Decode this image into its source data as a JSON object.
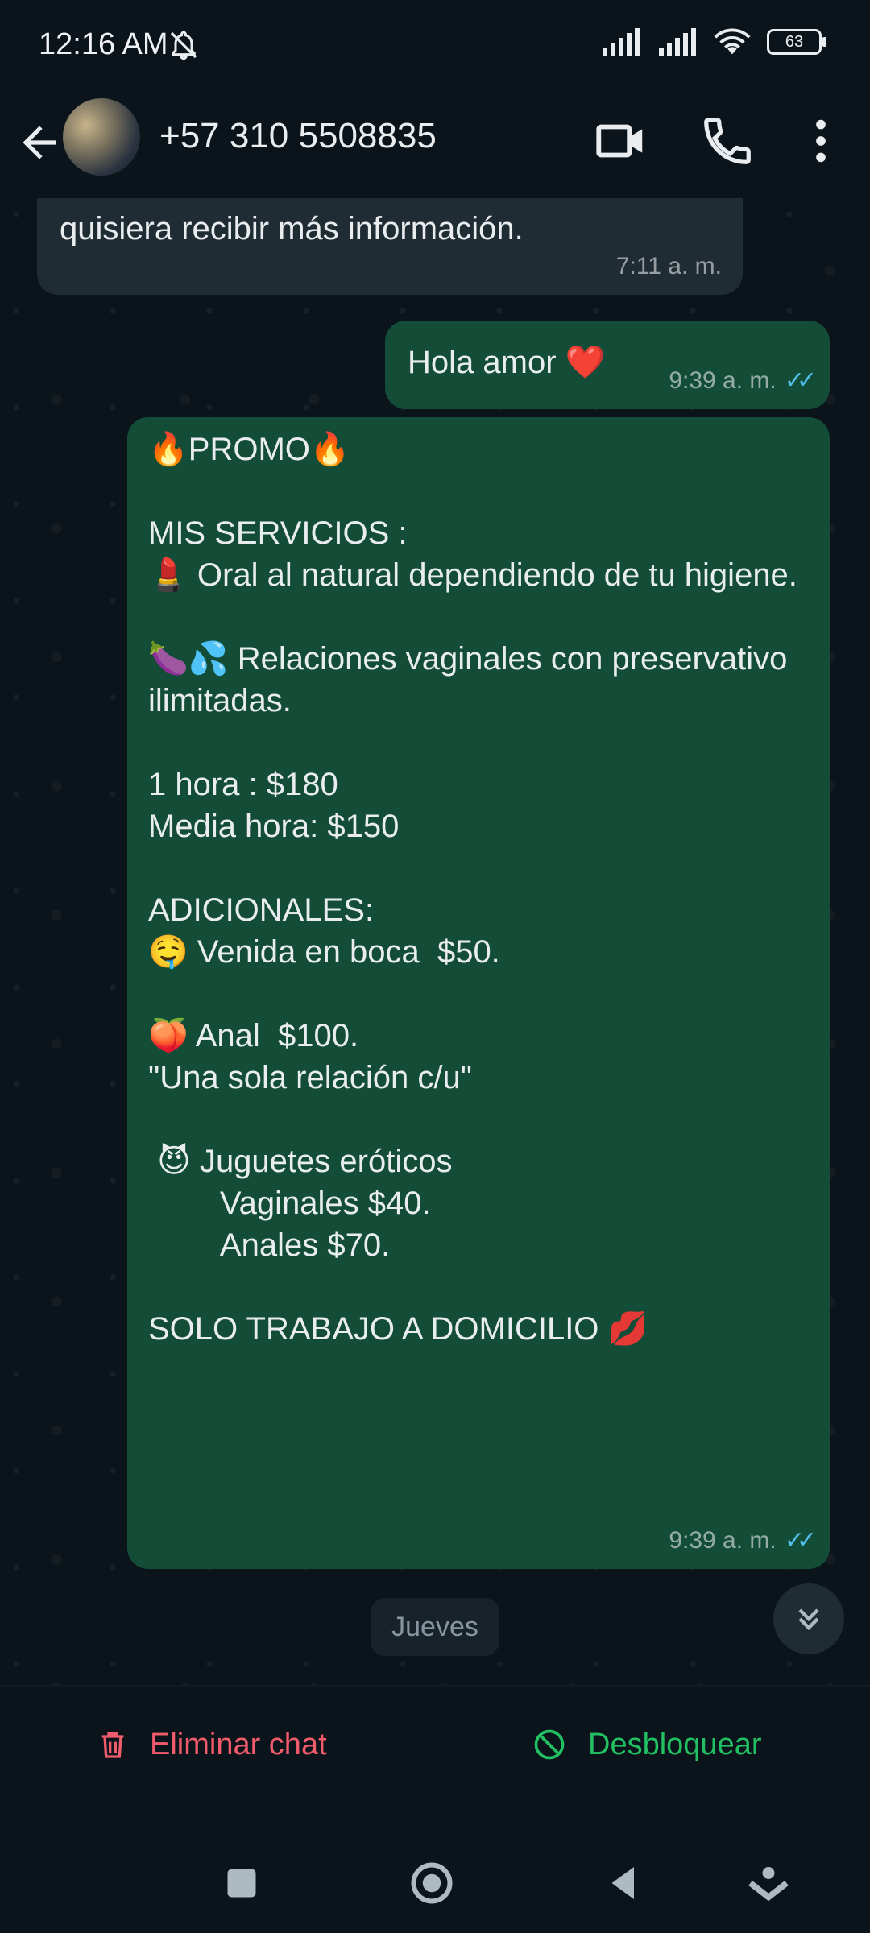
{
  "status": {
    "time": "12:16 AM",
    "battery": "63"
  },
  "header": {
    "contact": "+57 310 5508835"
  },
  "messages": [
    {
      "direction": "in",
      "text": "quisiera recibir más información.",
      "time": "7:11 a. m."
    },
    {
      "direction": "out",
      "text": "Hola amor ❤️",
      "time": "9:39 a. m."
    },
    {
      "direction": "out",
      "text": "🔥PROMO🔥\n\nMIS SERVICIOS :\n💄 Oral al natural dependiendo de tu higiene.\n\n🍆💦 Relaciones vaginales con preservativo ilimitadas.\n\n1 hora : $180\nMedia hora: $150\n\nADICIONALES:\n🤤 Venida en boca  $50.\n\n🍑 Anal  $100.\n\"Una sola relación c/u\"\n\n 😈 Juguetes eróticos\n        Vaginales $40.\n        Anales $70.\n\nSOLO TRABAJO A DOMICILIO 💋",
      "time": "9:39 a. m."
    }
  ],
  "day_chip": "Jueves",
  "actions": {
    "delete_label": "Eliminar chat",
    "unblock_label": "Desbloquear"
  },
  "colors": {
    "background": "#0b141a",
    "incoming_bubble": "#202c33",
    "outgoing_bubble": "#144d37",
    "read_ticks": "#53bdeb",
    "delete": "#f15c6d",
    "unblock": "#21c063"
  }
}
